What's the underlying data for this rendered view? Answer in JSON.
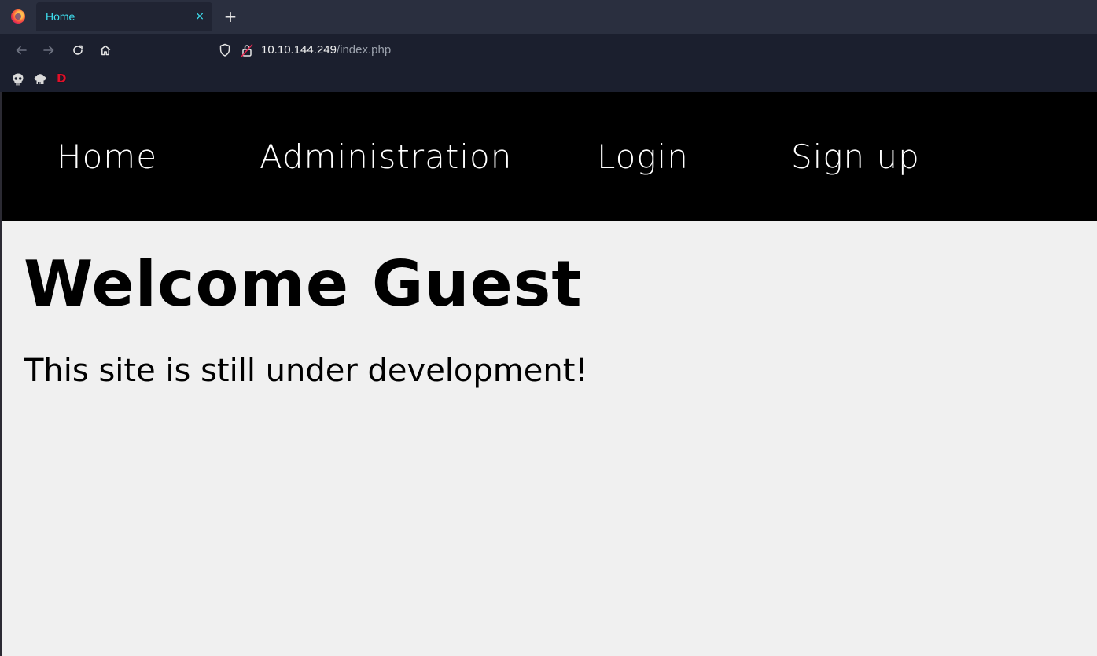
{
  "browser": {
    "tab": {
      "title": "Home",
      "close_glyph": "×"
    },
    "new_tab_glyph": "+",
    "url": {
      "host": "10.10.144.249",
      "path": "/index.php"
    },
    "bookmarks": [
      {
        "icon": "skull-icon"
      },
      {
        "icon": "chef-hat-icon"
      },
      {
        "label": "D",
        "color": "#e0102a"
      }
    ],
    "accent_color": "#3ee0f0"
  },
  "site": {
    "nav": [
      "Home",
      "Administration",
      "Login",
      "Sign up"
    ],
    "heading": "Welcome Guest",
    "message": "This site is still under development!"
  }
}
